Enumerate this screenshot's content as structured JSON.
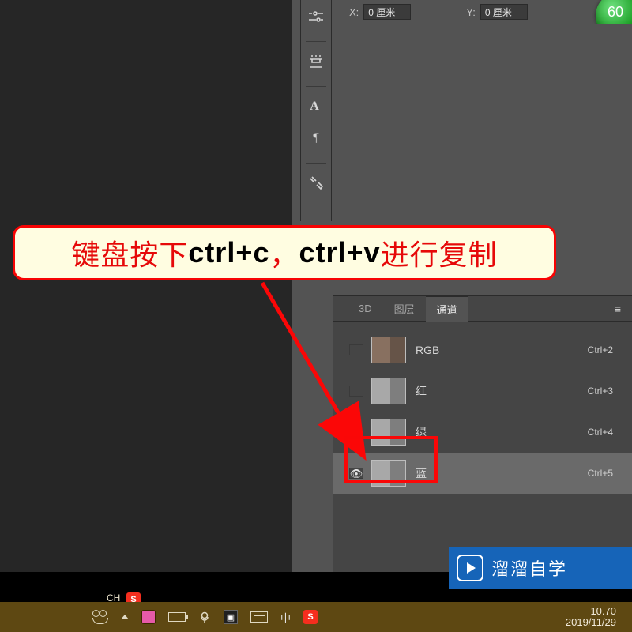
{
  "topbar": {
    "x_label": "X:",
    "x_value": "0 厘米",
    "y_label": "Y:",
    "y_value": "0 厘米",
    "badge": "60"
  },
  "callout": {
    "pre": "键盘按下",
    "kbd1": "ctrl+c",
    "sep": "，",
    "kbd2": "ctrl+v",
    "post": "进行复制"
  },
  "panel": {
    "tabs": {
      "t1": "3D",
      "t2": "图层",
      "t3": "通道"
    },
    "channels": [
      {
        "name": "RGB",
        "shortcut": "Ctrl+2",
        "visible": false,
        "color": true
      },
      {
        "name": "红",
        "shortcut": "Ctrl+3",
        "visible": false,
        "color": false
      },
      {
        "name": "绿",
        "shortcut": "Ctrl+4",
        "visible": false,
        "color": false
      },
      {
        "name": "蓝",
        "shortcut": "Ctrl+5",
        "visible": true,
        "color": false
      }
    ]
  },
  "brand": "溜溜自学",
  "taskbar": {
    "lang": "CH",
    "ime": "S",
    "zhong": "中",
    "time": "10.70",
    "date": "2019/11/29"
  }
}
